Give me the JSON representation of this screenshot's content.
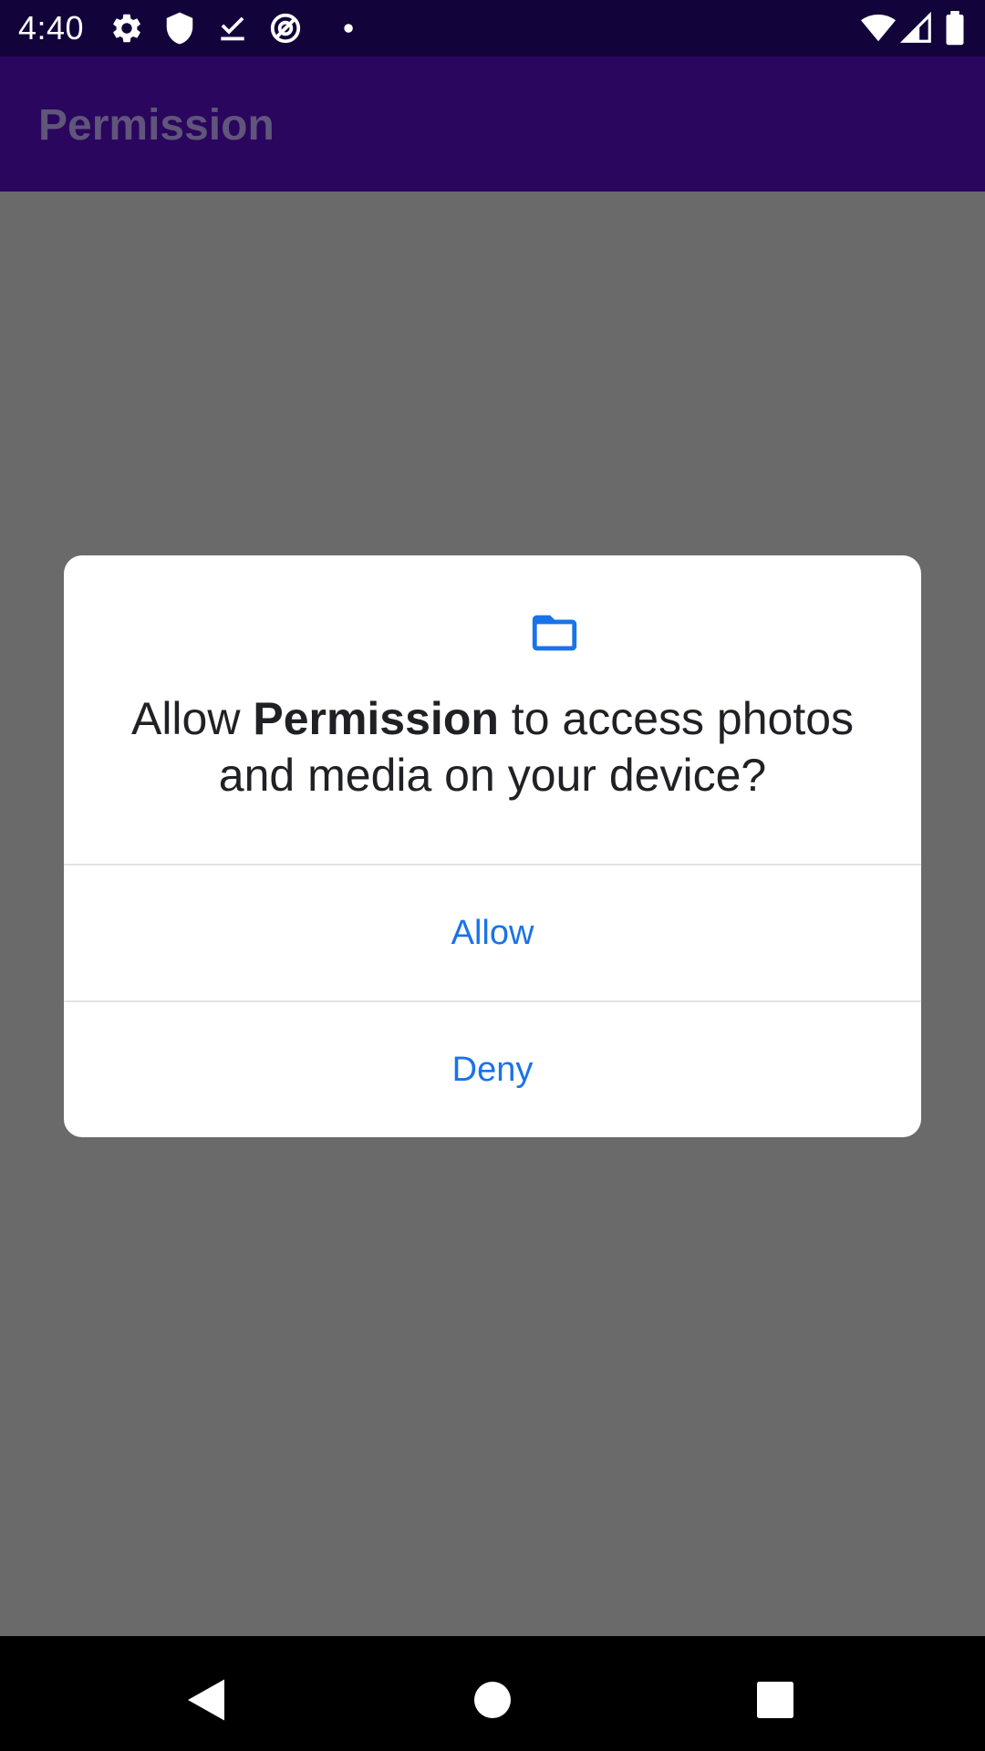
{
  "status_bar": {
    "time": "4:40",
    "left_icons": [
      "gear-icon",
      "shield-icon",
      "download-done-icon",
      "at-sign-icon",
      "dot-icon"
    ],
    "right_icons": [
      "wifi-icon",
      "cell-signal-icon",
      "battery-icon"
    ]
  },
  "app_bar": {
    "title": "Permission",
    "background_color": "#2a065e"
  },
  "dialog": {
    "icon": "folder-icon",
    "message_prefix": "Allow ",
    "app_name": "Permission",
    "message_suffix": " to access photos and media on your device?",
    "allow_label": "Allow",
    "deny_label": "Deny",
    "accent_color": "#1a73e8"
  },
  "nav_bar": {
    "buttons": [
      "back-icon",
      "home-icon",
      "recents-icon"
    ]
  }
}
